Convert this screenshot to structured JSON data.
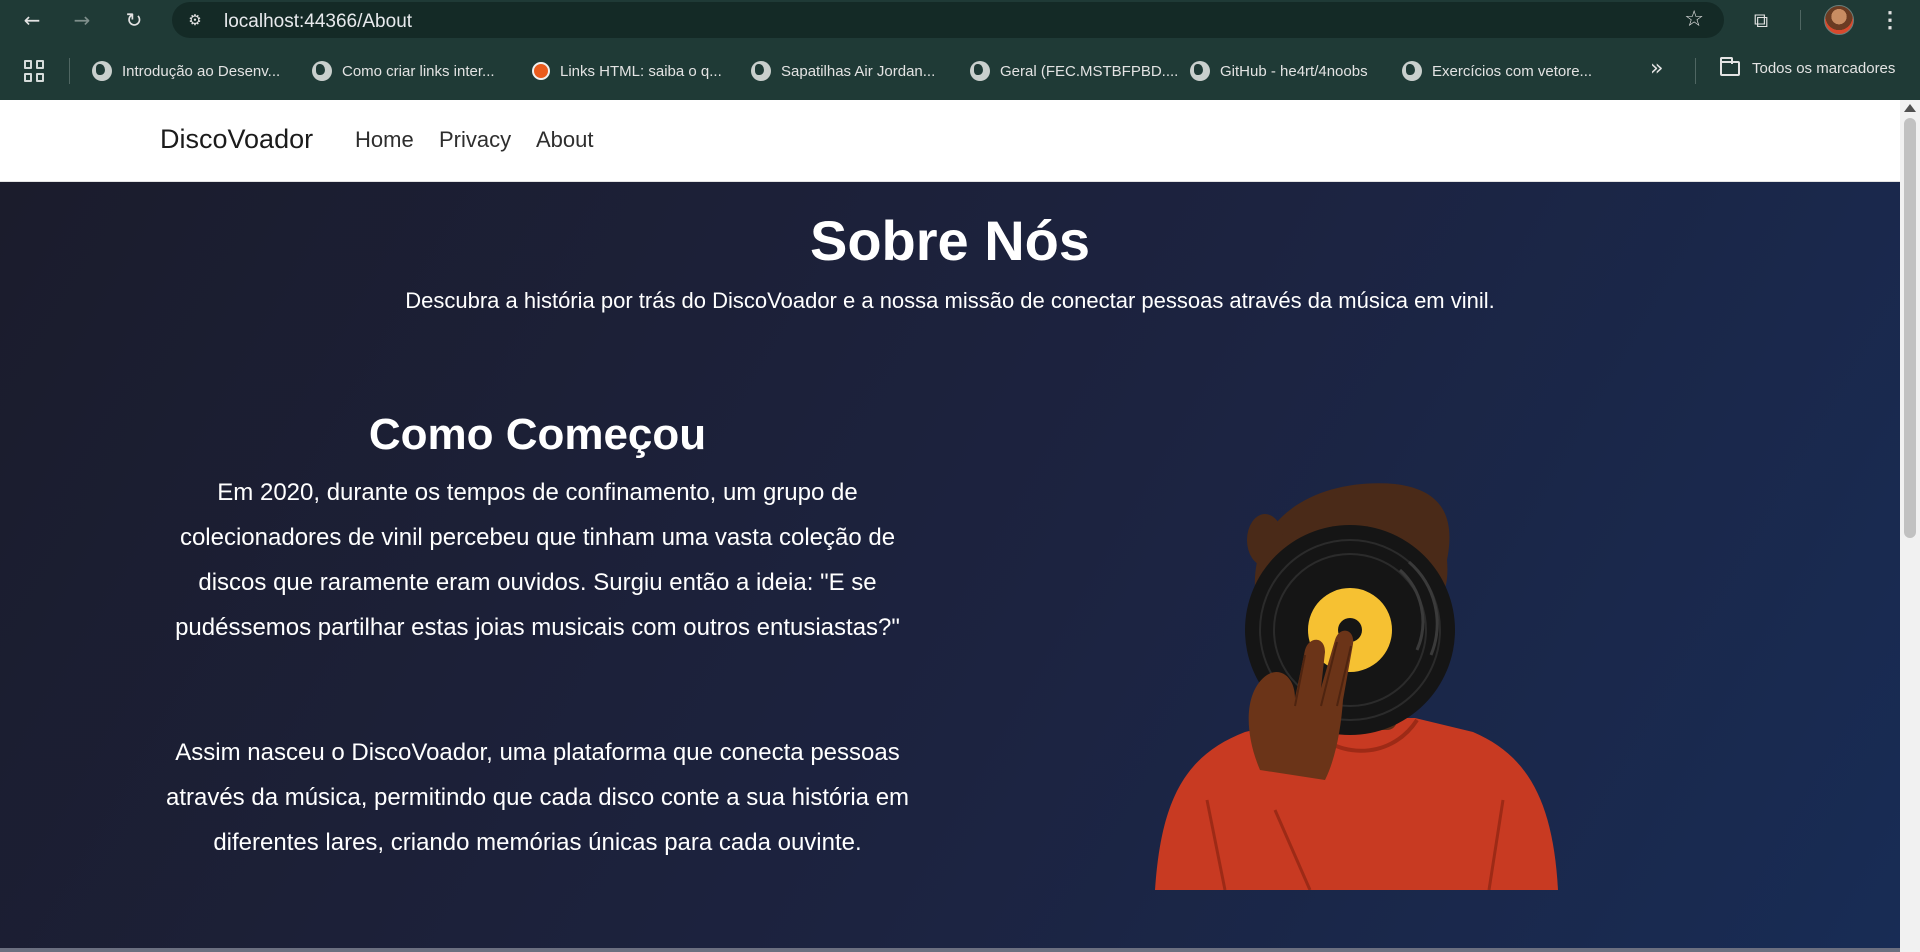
{
  "browser": {
    "url": "localhost:44366/About",
    "bookmarks": [
      {
        "label": "Introdução ao Desenv...",
        "icon": "globe-icon"
      },
      {
        "label": "Como criar links inter...",
        "icon": "globe-icon"
      },
      {
        "label": "Links HTML: saiba o q...",
        "icon": "orange-favicon-icon"
      },
      {
        "label": "Sapatilhas Air Jordan...",
        "icon": "globe-icon"
      },
      {
        "label": "Geral (FEC.MSTBFPBD....",
        "icon": "globe-icon"
      },
      {
        "label": "GitHub - he4rt/4noobs",
        "icon": "globe-icon"
      },
      {
        "label": "Exercícios com vetore...",
        "icon": "globe-icon"
      }
    ],
    "more_bookmarks": "»",
    "all_bookmarks_label": "Todos os marcadores"
  },
  "site": {
    "brand": "DiscoVoador",
    "nav": [
      "Home",
      "Privacy",
      "About"
    ]
  },
  "hero": {
    "title": "Sobre Nós",
    "subtitle": "Descubra a história por trás do DiscoVoador e a nossa missão de conectar pessoas através da música em vinil."
  },
  "story": {
    "title": "Como Começou",
    "paragraphs": [
      "Em 2020, durante os tempos de confinamento, um grupo de colecionadores de vinil percebeu que tinham uma vasta coleção de discos que raramente eram ouvidos. Surgiu então a ideia: \"E se pudéssemos partilhar estas joias musicais com outros entusiastas?\"",
      "Assim nasceu o DiscoVoador, uma plataforma que conecta pessoas através da música, permitindo que cada disco conte a sua história em diferentes lares, criando memórias únicas para cada ouvinte."
    ]
  },
  "colors": {
    "chrome": "#1f3a36",
    "hero_start": "#1b1c2c",
    "hero_end": "#182c55",
    "shirt": "#c83a22",
    "record_label": "#f6c132"
  }
}
